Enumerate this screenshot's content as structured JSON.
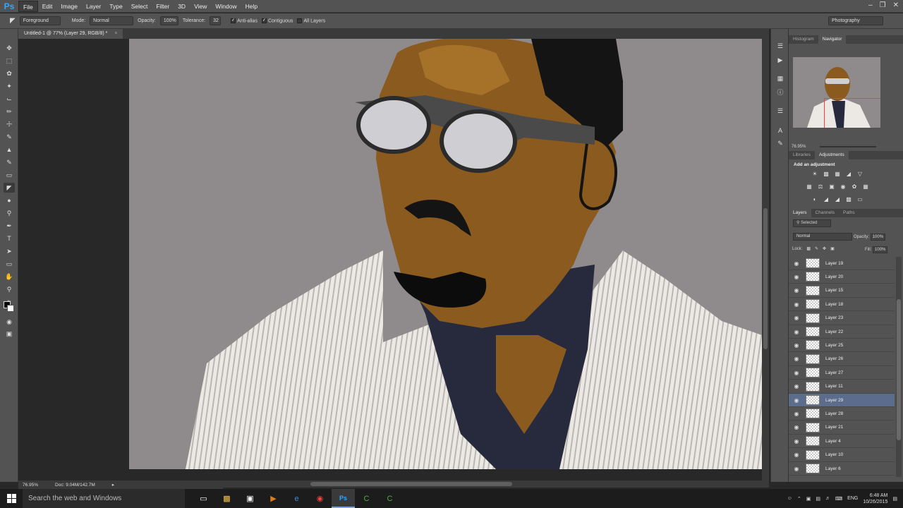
{
  "app": {
    "logo": "Ps"
  },
  "menu": [
    "File",
    "Edit",
    "Image",
    "Layer",
    "Type",
    "Select",
    "Filter",
    "3D",
    "View",
    "Window",
    "Help"
  ],
  "options": {
    "fill_source": "Foreground",
    "mode_label": "Mode:",
    "mode_value": "Normal",
    "opacity_label": "Opacity:",
    "opacity_value": "100%",
    "tolerance_label": "Tolerance:",
    "tolerance_value": "32",
    "anti_alias": "Anti-alias",
    "contiguous": "Contiguous",
    "all_layers": "All Layers",
    "workspace": "Photography"
  },
  "document": {
    "tab_title": "Untitled-1 @ 77% (Layer 29, RGB/8) *"
  },
  "status": {
    "zoom": "76.95%",
    "doc_size": "Doc: 9.04M/142.7M"
  },
  "panels": {
    "top_tabs": [
      "Histogram",
      "Navigator"
    ],
    "navigator_zoom": "76.95%",
    "adj_tabs": [
      "Libraries",
      "Adjustments"
    ],
    "adj_title": "Add an adjustment",
    "layer_tabs": [
      "Layers",
      "Channels",
      "Paths"
    ],
    "layer_filter": "Selected",
    "blend_mode": "Normal",
    "opacity_label": "Opacity:",
    "opacity_value": "100%",
    "lock_label": "Lock:",
    "fill_label": "Fill:",
    "fill_value": "100%"
  },
  "layers": [
    {
      "name": "Layer 19",
      "selected": false
    },
    {
      "name": "Layer 20",
      "selected": false
    },
    {
      "name": "Layer 15",
      "selected": false
    },
    {
      "name": "Layer 18",
      "selected": false
    },
    {
      "name": "Layer 23",
      "selected": false
    },
    {
      "name": "Layer 22",
      "selected": false
    },
    {
      "name": "Layer 25",
      "selected": false
    },
    {
      "name": "Layer 26",
      "selected": false
    },
    {
      "name": "Layer 27",
      "selected": false
    },
    {
      "name": "Layer 11",
      "selected": false
    },
    {
      "name": "Layer 29",
      "selected": true
    },
    {
      "name": "Layer 28",
      "selected": false
    },
    {
      "name": "Layer 21",
      "selected": false
    },
    {
      "name": "Layer 4",
      "selected": false
    },
    {
      "name": "Layer 10",
      "selected": false
    },
    {
      "name": "Layer 6",
      "selected": false
    }
  ],
  "taskbar": {
    "search_placeholder": "Search the web and Windows",
    "language": "ENG",
    "time": "6:48 AM",
    "date": "10/26/2015"
  },
  "colors": {
    "accent": "#31a8ff",
    "selected_layer": "#5b6c8c",
    "canvas_bg": "#8f8b8d"
  }
}
